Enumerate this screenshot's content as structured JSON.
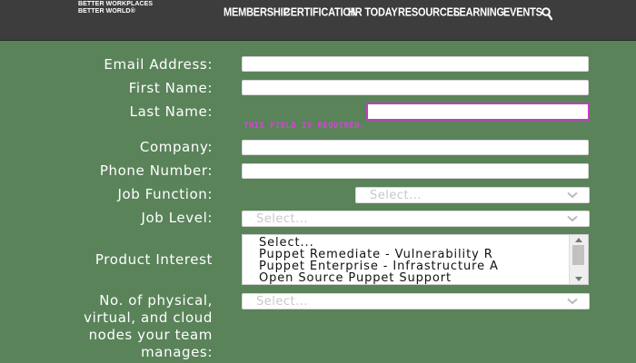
{
  "header": {
    "brand_line1": "BETTER WORKPLACES",
    "brand_line2": "BETTER WORLD®",
    "nav": [
      {
        "label": "MEMBERSHIP"
      },
      {
        "label": "CERTIFICATION"
      },
      {
        "label": "HR TODAY"
      },
      {
        "label": "RESOURCES"
      },
      {
        "label": "LEARNING"
      },
      {
        "label": "EVENTS"
      }
    ],
    "search_icon": "search-icon"
  },
  "form": {
    "email_label": "Email Address:",
    "first_name_label": "First Name:",
    "last_name_label": "Last Name:",
    "last_name_error": "THIS FIELD IS REQUIRED.",
    "company_label": "Company:",
    "phone_label": "Phone Number:",
    "job_function_label": "Job Function:",
    "job_function_placeholder": "Select...",
    "job_level_label": "Job Level:",
    "job_level_placeholder": "Select...",
    "product_interest_label": "Product Interest",
    "product_interest_options": [
      "Select...",
      "Puppet Remediate - Vulnerability R",
      "Puppet Enterprise - Infrastructure A",
      "Open Source Puppet Support"
    ],
    "nodes_label_line1": "No. of physical,",
    "nodes_label_line2": "virtual, and cloud",
    "nodes_label_line3": "nodes your team",
    "nodes_label_line4": "manages:",
    "nodes_placeholder": "Select..."
  },
  "colors": {
    "background": "#5a835a",
    "header": "#3d3d3d",
    "error": "#d942d9"
  }
}
